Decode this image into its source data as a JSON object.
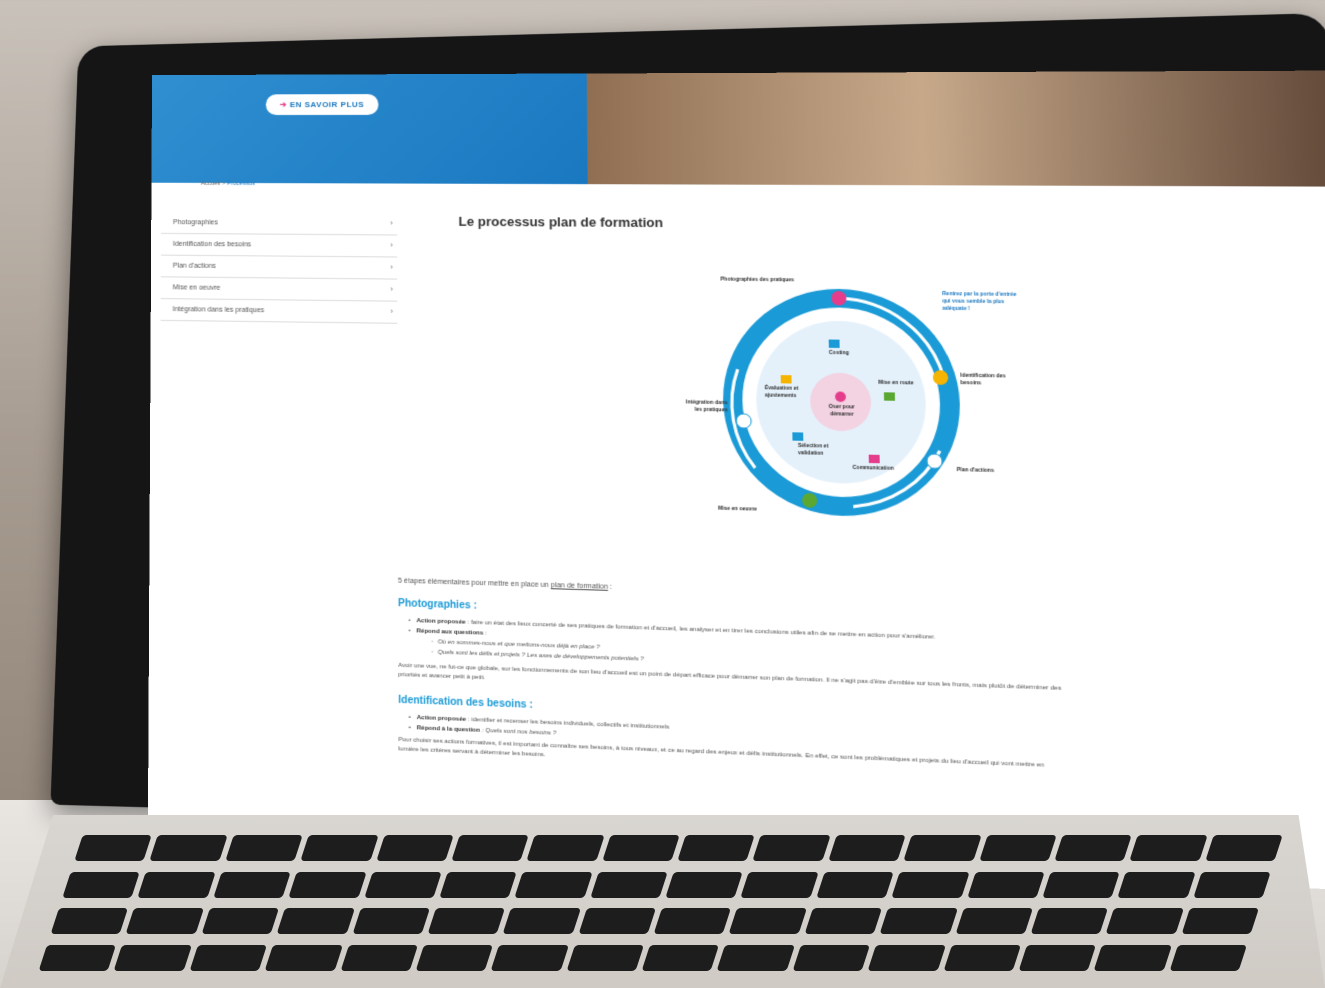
{
  "hero": {
    "cta_label": "EN SAVOIR PLUS"
  },
  "breadcrumb": {
    "home": "Accueil",
    "sep": ">",
    "current": "Processus"
  },
  "sidebar": {
    "items": [
      {
        "label": "Photographies"
      },
      {
        "label": "Identification des besoins"
      },
      {
        "label": "Plan d'actions"
      },
      {
        "label": "Mise en oeuvre"
      },
      {
        "label": "Intégration dans les pratiques"
      }
    ],
    "chevron": "›"
  },
  "page": {
    "title": "Le processus plan de formation"
  },
  "diagram": {
    "labels": {
      "top": "Photographies des pratiques",
      "note": "Rentrez par la porte d'entrée qui vous semble la plus adéquate !",
      "right_top": "Identification des besoins",
      "right_bottom": "Plan d'actions",
      "bottom": "Mise en oeuvre",
      "left": "Intégration dans les pratiques",
      "center": "Oser pour démarrer",
      "costing": "Costing",
      "mise_en_route": "Mise en route",
      "evaluation": "Évaluation et ajustements",
      "selection": "Sélection et validation",
      "communication": "Communication"
    },
    "colors": {
      "ring": "#1a9ad6",
      "inner": "#e4f1fb",
      "center": "#f3d2e2",
      "accent": "#e53d8c"
    }
  },
  "intro": {
    "text": "5 étapes élémentaires pour mettre en place un",
    "link": "plan de formation",
    "after": ":"
  },
  "sections": {
    "photographies": {
      "heading": "Photographies :",
      "action_label": "Action proposée",
      "action_text": ": faire un état des lieux concerté de ses pratiques de formation et d'accueil, les analyser et en tirer les conclusions utiles afin de se mettre en action pour s'améliorer.",
      "questions_label": "Répond aux questions",
      "questions_after": ":",
      "q1": "Où en sommes-nous et que mettons-nous déjà en place ?",
      "q2": "Quels sont les défis et projets ? Les axes de développements potentiels ?",
      "para1": "Avoir une vue, ne fut-ce que globale, sur les fonctionnements de son lieu d'accueil est un point de départ efficace pour démarrer son plan de formation. Il ne s'agit pas d'être d'emblée sur tous les fronts, mais plutôt de déterminer des",
      "para2": "priorités et avancer petit à petit."
    },
    "identification": {
      "heading": "Identification des besoins :",
      "action_label": "Action proposée",
      "action_text": ": identifier et recenser les besoins individuels, collectifs et institutionnels",
      "question_label": "Répond à la question",
      "question_text": ": Quels sont nos besoins ?",
      "para1": "Pour choisir ses actions formatives, il est important de connaître ses besoins, à tous niveaux, et ce au regard des enjeux et défis institutionnels. En effet, ce sont les problématiques et projets du lieu d'accueil qui vont mettre en",
      "para2": "lumière les critères servant à déterminer les besoins."
    }
  }
}
